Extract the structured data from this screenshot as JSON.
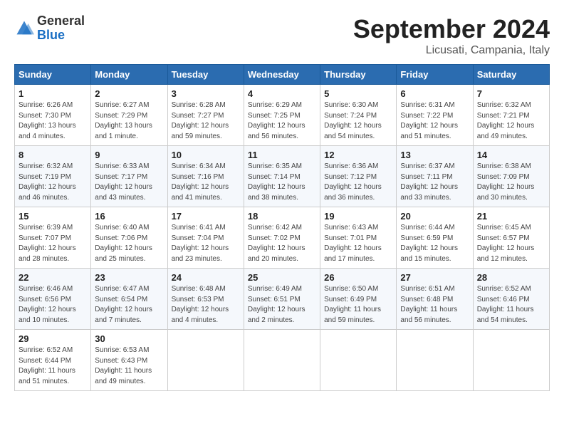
{
  "header": {
    "logo_line1": "General",
    "logo_line2": "Blue",
    "month": "September 2024",
    "location": "Licusati, Campania, Italy"
  },
  "weekdays": [
    "Sunday",
    "Monday",
    "Tuesday",
    "Wednesday",
    "Thursday",
    "Friday",
    "Saturday"
  ],
  "weeks": [
    [
      {
        "day": "1",
        "sunrise": "Sunrise: 6:26 AM",
        "sunset": "Sunset: 7:30 PM",
        "daylight": "Daylight: 13 hours and 4 minutes."
      },
      {
        "day": "2",
        "sunrise": "Sunrise: 6:27 AM",
        "sunset": "Sunset: 7:29 PM",
        "daylight": "Daylight: 13 hours and 1 minute."
      },
      {
        "day": "3",
        "sunrise": "Sunrise: 6:28 AM",
        "sunset": "Sunset: 7:27 PM",
        "daylight": "Daylight: 12 hours and 59 minutes."
      },
      {
        "day": "4",
        "sunrise": "Sunrise: 6:29 AM",
        "sunset": "Sunset: 7:25 PM",
        "daylight": "Daylight: 12 hours and 56 minutes."
      },
      {
        "day": "5",
        "sunrise": "Sunrise: 6:30 AM",
        "sunset": "Sunset: 7:24 PM",
        "daylight": "Daylight: 12 hours and 54 minutes."
      },
      {
        "day": "6",
        "sunrise": "Sunrise: 6:31 AM",
        "sunset": "Sunset: 7:22 PM",
        "daylight": "Daylight: 12 hours and 51 minutes."
      },
      {
        "day": "7",
        "sunrise": "Sunrise: 6:32 AM",
        "sunset": "Sunset: 7:21 PM",
        "daylight": "Daylight: 12 hours and 49 minutes."
      }
    ],
    [
      {
        "day": "8",
        "sunrise": "Sunrise: 6:32 AM",
        "sunset": "Sunset: 7:19 PM",
        "daylight": "Daylight: 12 hours and 46 minutes."
      },
      {
        "day": "9",
        "sunrise": "Sunrise: 6:33 AM",
        "sunset": "Sunset: 7:17 PM",
        "daylight": "Daylight: 12 hours and 43 minutes."
      },
      {
        "day": "10",
        "sunrise": "Sunrise: 6:34 AM",
        "sunset": "Sunset: 7:16 PM",
        "daylight": "Daylight: 12 hours and 41 minutes."
      },
      {
        "day": "11",
        "sunrise": "Sunrise: 6:35 AM",
        "sunset": "Sunset: 7:14 PM",
        "daylight": "Daylight: 12 hours and 38 minutes."
      },
      {
        "day": "12",
        "sunrise": "Sunrise: 6:36 AM",
        "sunset": "Sunset: 7:12 PM",
        "daylight": "Daylight: 12 hours and 36 minutes."
      },
      {
        "day": "13",
        "sunrise": "Sunrise: 6:37 AM",
        "sunset": "Sunset: 7:11 PM",
        "daylight": "Daylight: 12 hours and 33 minutes."
      },
      {
        "day": "14",
        "sunrise": "Sunrise: 6:38 AM",
        "sunset": "Sunset: 7:09 PM",
        "daylight": "Daylight: 12 hours and 30 minutes."
      }
    ],
    [
      {
        "day": "15",
        "sunrise": "Sunrise: 6:39 AM",
        "sunset": "Sunset: 7:07 PM",
        "daylight": "Daylight: 12 hours and 28 minutes."
      },
      {
        "day": "16",
        "sunrise": "Sunrise: 6:40 AM",
        "sunset": "Sunset: 7:06 PM",
        "daylight": "Daylight: 12 hours and 25 minutes."
      },
      {
        "day": "17",
        "sunrise": "Sunrise: 6:41 AM",
        "sunset": "Sunset: 7:04 PM",
        "daylight": "Daylight: 12 hours and 23 minutes."
      },
      {
        "day": "18",
        "sunrise": "Sunrise: 6:42 AM",
        "sunset": "Sunset: 7:02 PM",
        "daylight": "Daylight: 12 hours and 20 minutes."
      },
      {
        "day": "19",
        "sunrise": "Sunrise: 6:43 AM",
        "sunset": "Sunset: 7:01 PM",
        "daylight": "Daylight: 12 hours and 17 minutes."
      },
      {
        "day": "20",
        "sunrise": "Sunrise: 6:44 AM",
        "sunset": "Sunset: 6:59 PM",
        "daylight": "Daylight: 12 hours and 15 minutes."
      },
      {
        "day": "21",
        "sunrise": "Sunrise: 6:45 AM",
        "sunset": "Sunset: 6:57 PM",
        "daylight": "Daylight: 12 hours and 12 minutes."
      }
    ],
    [
      {
        "day": "22",
        "sunrise": "Sunrise: 6:46 AM",
        "sunset": "Sunset: 6:56 PM",
        "daylight": "Daylight: 12 hours and 10 minutes."
      },
      {
        "day": "23",
        "sunrise": "Sunrise: 6:47 AM",
        "sunset": "Sunset: 6:54 PM",
        "daylight": "Daylight: 12 hours and 7 minutes."
      },
      {
        "day": "24",
        "sunrise": "Sunrise: 6:48 AM",
        "sunset": "Sunset: 6:53 PM",
        "daylight": "Daylight: 12 hours and 4 minutes."
      },
      {
        "day": "25",
        "sunrise": "Sunrise: 6:49 AM",
        "sunset": "Sunset: 6:51 PM",
        "daylight": "Daylight: 12 hours and 2 minutes."
      },
      {
        "day": "26",
        "sunrise": "Sunrise: 6:50 AM",
        "sunset": "Sunset: 6:49 PM",
        "daylight": "Daylight: 11 hours and 59 minutes."
      },
      {
        "day": "27",
        "sunrise": "Sunrise: 6:51 AM",
        "sunset": "Sunset: 6:48 PM",
        "daylight": "Daylight: 11 hours and 56 minutes."
      },
      {
        "day": "28",
        "sunrise": "Sunrise: 6:52 AM",
        "sunset": "Sunset: 6:46 PM",
        "daylight": "Daylight: 11 hours and 54 minutes."
      }
    ],
    [
      {
        "day": "29",
        "sunrise": "Sunrise: 6:52 AM",
        "sunset": "Sunset: 6:44 PM",
        "daylight": "Daylight: 11 hours and 51 minutes."
      },
      {
        "day": "30",
        "sunrise": "Sunrise: 6:53 AM",
        "sunset": "Sunset: 6:43 PM",
        "daylight": "Daylight: 11 hours and 49 minutes."
      },
      null,
      null,
      null,
      null,
      null
    ]
  ]
}
